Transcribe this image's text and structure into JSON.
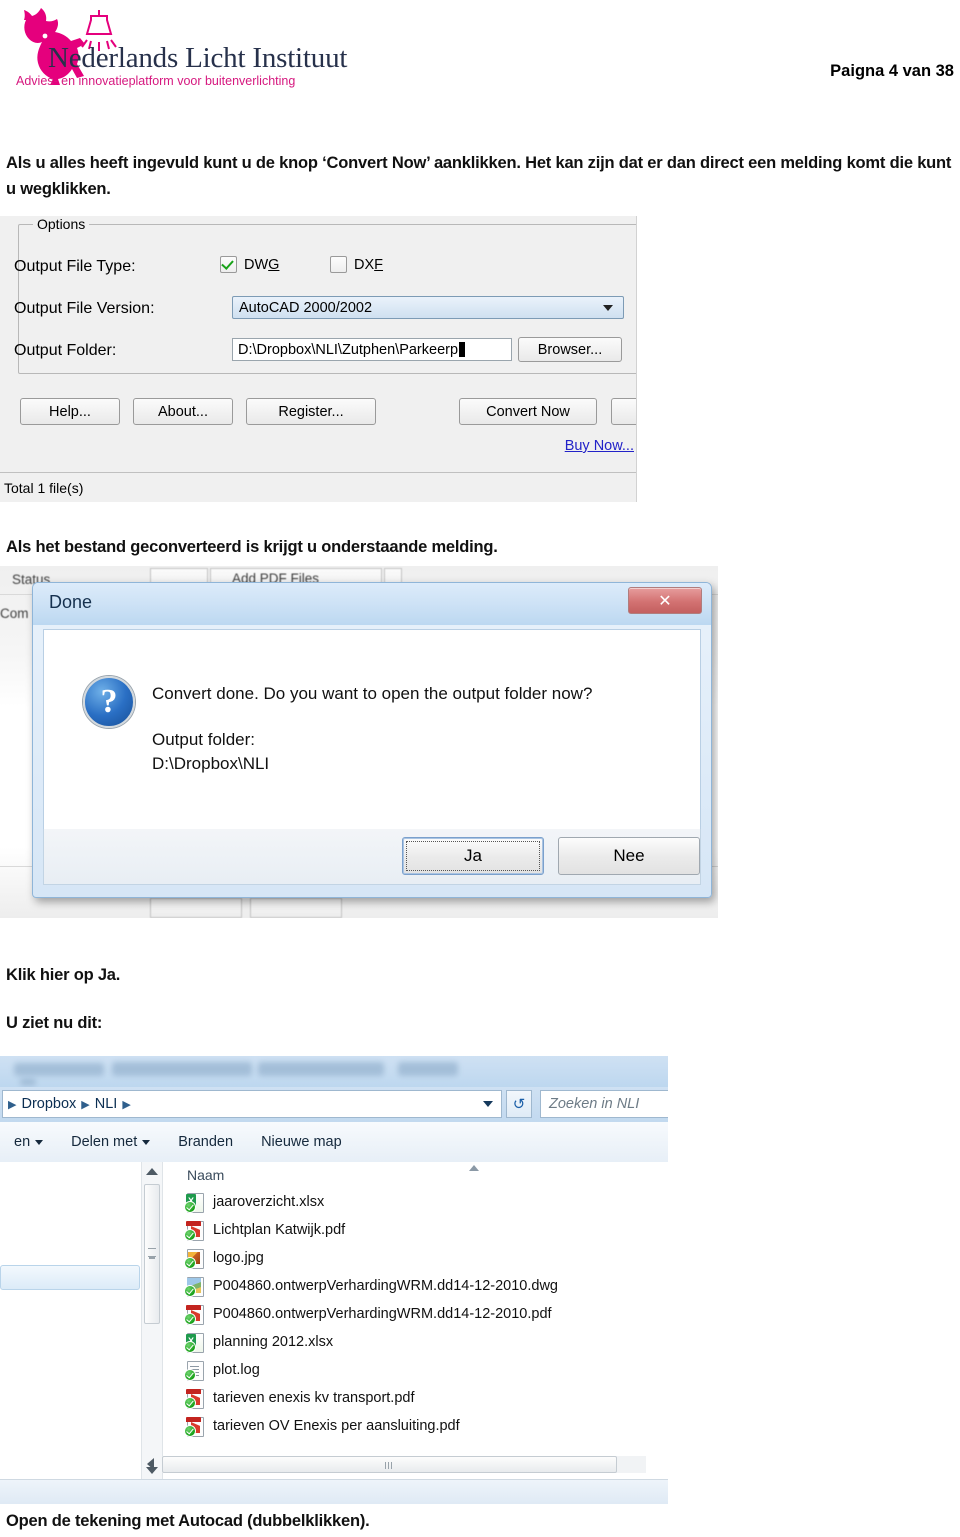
{
  "header": {
    "logo_title": "Nederlands Licht Instituut",
    "logo_tagline": "Advies- en innovatieplatform voor buitenverlichting",
    "page_number": "Paigna 4 van 38"
  },
  "paragraphs": {
    "intro": "Als u alles heeft ingevuld kunt u de knop ‘Convert Now’ aanklikken. Het kan zijn dat er dan direct een melding komt die kunt u wegklikken.",
    "after_options": "Als het bestand geconverteerd is krijgt u onderstaande melding.",
    "click_ja": "Klik hier op Ja.",
    "you_see": "U ziet nu dit:",
    "open_drawing": "Open de tekening met Autocad (dubbelklikken)."
  },
  "converter": {
    "group_label": "Options",
    "labels": {
      "file_type": "Output File Type:",
      "file_version": "Output File Version:",
      "folder": "Output Folder:"
    },
    "checkboxes": [
      {
        "label_pre": "DW",
        "label_mnemonic": "G",
        "label_post": "",
        "checked": true,
        "name": "dwg"
      },
      {
        "label_pre": "DX",
        "label_mnemonic": "F",
        "label_post": "",
        "checked": false,
        "name": "dxf"
      }
    ],
    "file_version_value": "AutoCAD 2000/2002",
    "folder_value": "D:\\Dropbox\\NLI\\Zutphen\\Parkeerp",
    "browser_button": "Browser...",
    "buttons": {
      "help": "Help...",
      "about": "About...",
      "register": "Register...",
      "convert": "Convert Now"
    },
    "buy_now": "Buy Now...",
    "status": "Total 1 file(s)"
  },
  "done_dialog": {
    "title": "Done",
    "close_label": "✕",
    "icon": "question-icon",
    "message": "Convert done. Do you want to open the output folder now?",
    "output_folder_label": "Output folder:",
    "output_folder_path": "D:\\Dropbox\\NLI",
    "buttons": {
      "yes": "Ja",
      "no": "Nee"
    },
    "background_labels": [
      "Status",
      "Com",
      "Add PDF Files"
    ]
  },
  "explorer": {
    "breadcrumb": [
      "Dropbox",
      "NLI"
    ],
    "search_placeholder": "Zoeken in NLI",
    "toolbar": [
      "en",
      "Delen met",
      "Branden",
      "Nieuwe map"
    ],
    "column_header": "Naam",
    "files": [
      {
        "name": "jaaroverzicht.xlsx",
        "type": "xlsx",
        "badge": "X"
      },
      {
        "name": "Lichtplan Katwijk.pdf",
        "type": "pdf",
        "badge": ""
      },
      {
        "name": "logo.jpg",
        "type": "jpg",
        "badge": ""
      },
      {
        "name": "P004860.ontwerpVerhardingWRM.dd14-12-2010.dwg",
        "type": "dwg",
        "badge": ""
      },
      {
        "name": "P004860.ontwerpVerhardingWRM.dd14-12-2010.pdf",
        "type": "pdf",
        "badge": ""
      },
      {
        "name": "planning 2012.xlsx",
        "type": "xlsx",
        "badge": "X"
      },
      {
        "name": "plot.log",
        "type": "log",
        "badge": ""
      },
      {
        "name": "tarieven enexis kv transport.pdf",
        "type": "pdf",
        "badge": ""
      },
      {
        "name": "tarieven OV Enexis per aansluiting.pdf",
        "type": "pdf",
        "badge": ""
      }
    ]
  },
  "colors": {
    "brand_pink": "#d6187f",
    "brand_navy": "#27314b",
    "link_blue": "#2222c8",
    "close_red": "#c35f5f",
    "sync_green": "#17a017"
  }
}
